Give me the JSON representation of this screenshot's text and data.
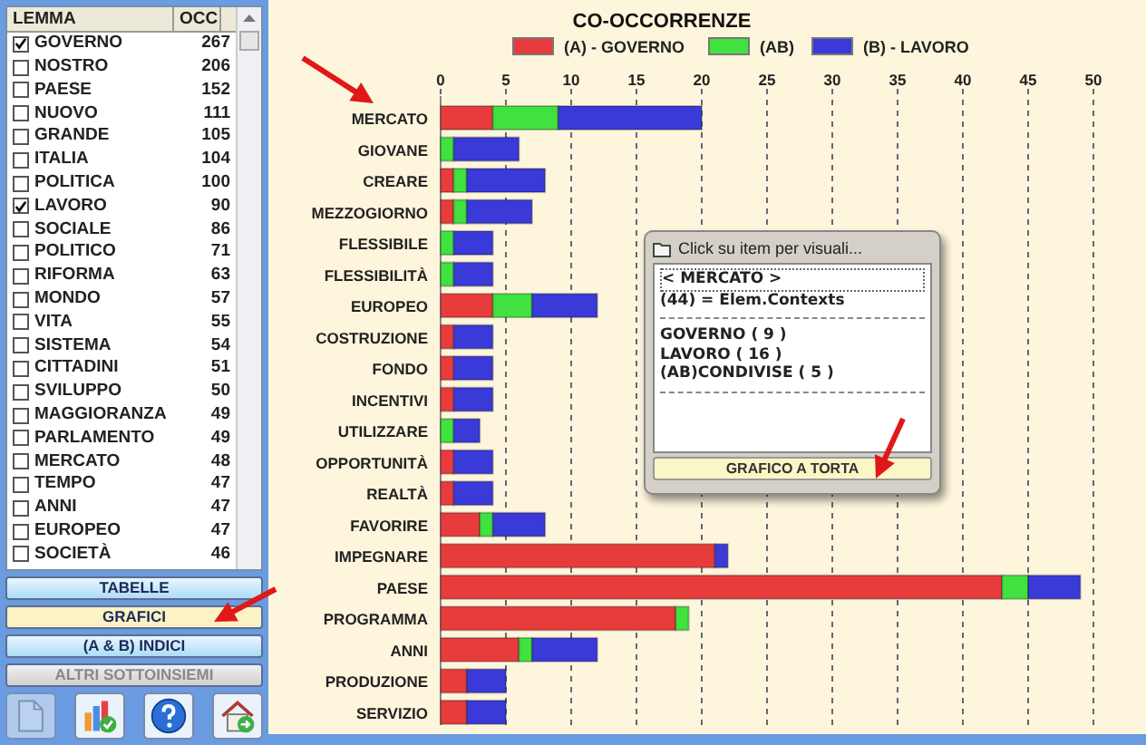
{
  "sidebar": {
    "columns": [
      "LEMMA",
      "OCC"
    ],
    "items": [
      {
        "label": "GOVERNO",
        "count": "267",
        "checked": true
      },
      {
        "label": "NOSTRO",
        "count": "206",
        "checked": false
      },
      {
        "label": "PAESE",
        "count": "152",
        "checked": false
      },
      {
        "label": "NUOVO",
        "count": "111",
        "checked": false
      },
      {
        "label": "GRANDE",
        "count": "105",
        "checked": false
      },
      {
        "label": "ITALIA",
        "count": "104",
        "checked": false
      },
      {
        "label": "POLITICA",
        "count": "100",
        "checked": false
      },
      {
        "label": "LAVORO",
        "count": "90",
        "checked": true
      },
      {
        "label": "SOCIALE",
        "count": "86",
        "checked": false
      },
      {
        "label": "POLITICO",
        "count": "71",
        "checked": false
      },
      {
        "label": "RIFORMA",
        "count": "63",
        "checked": false
      },
      {
        "label": "MONDO",
        "count": "57",
        "checked": false
      },
      {
        "label": "VITA",
        "count": "55",
        "checked": false
      },
      {
        "label": "SISTEMA",
        "count": "54",
        "checked": false
      },
      {
        "label": "CITTADINI",
        "count": "51",
        "checked": false
      },
      {
        "label": "SVILUPPO",
        "count": "50",
        "checked": false
      },
      {
        "label": "MAGGIORANZA",
        "count": "49",
        "checked": false
      },
      {
        "label": "PARLAMENTO",
        "count": "49",
        "checked": false
      },
      {
        "label": "MERCATO",
        "count": "48",
        "checked": false
      },
      {
        "label": "TEMPO",
        "count": "47",
        "checked": false
      },
      {
        "label": "ANNI",
        "count": "47",
        "checked": false
      },
      {
        "label": "EUROPEO",
        "count": "47",
        "checked": false
      },
      {
        "label": "SOCIETÀ",
        "count": "46",
        "checked": false
      }
    ],
    "buttons": [
      {
        "label": "TABELLE",
        "selected": false,
        "disabled": false
      },
      {
        "label": "GRAFICI",
        "selected": true,
        "disabled": false
      },
      {
        "label": "(A & B)  INDICI",
        "selected": false,
        "disabled": false
      },
      {
        "label": "ALTRI SOTTOINSIEMI",
        "selected": false,
        "disabled": true
      }
    ],
    "toolbar": [
      {
        "kind": "document",
        "disabled": true
      },
      {
        "kind": "chart",
        "disabled": false
      },
      {
        "kind": "help",
        "disabled": false
      },
      {
        "kind": "home",
        "disabled": false
      }
    ]
  },
  "chart": {
    "chart_data": {
      "type": "bar",
      "title": "CO-OCCORRENZE",
      "orientation": "horizontal",
      "stacked": true,
      "categories": [
        "MERCATO",
        "GIOVANE",
        "CREARE",
        "MEZZOGIORNO",
        "FLESSIBILE",
        "FLESSIBILITÀ",
        "EUROPEO",
        "COSTRUZIONE",
        "FONDO",
        "INCENTIVI",
        "UTILIZZARE",
        "OPPORTUNITÀ",
        "REALTÀ",
        "FAVORIRE",
        "IMPEGNARE",
        "PAESE",
        "PROGRAMMA",
        "ANNI",
        "PRODUZIONE",
        "SERVIZIO"
      ],
      "series": [
        {
          "name": "(A) - GOVERNO",
          "color": "#e83c3c",
          "values": [
            4,
            0,
            1,
            1,
            0,
            0,
            4,
            1,
            1,
            1,
            0,
            1,
            1,
            3,
            21,
            43,
            18,
            6,
            2,
            2
          ]
        },
        {
          "name": "(AB)",
          "color": "#3fe23f",
          "values": [
            5,
            1,
            1,
            1,
            1,
            1,
            3,
            0,
            0,
            0,
            1,
            0,
            0,
            1,
            0,
            2,
            1,
            1,
            0,
            0
          ]
        },
        {
          "name": "(B) - LAVORO",
          "color": "#3a3ad8",
          "values": [
            11,
            5,
            6,
            5,
            3,
            3,
            5,
            3,
            3,
            3,
            2,
            3,
            3,
            4,
            1,
            4,
            0,
            5,
            3,
            3
          ]
        }
      ],
      "xlim": [
        0,
        50
      ],
      "xticks": [
        0,
        5,
        10,
        15,
        20,
        25,
        30,
        35,
        40,
        45,
        50
      ],
      "grid": true,
      "legend": true
    }
  },
  "popup": {
    "title": "Click su item per visuali...",
    "header_lines": [
      {
        "text": "< MERCATO >",
        "selected": true
      },
      {
        "text": "(44) = Elem.Contexts",
        "selected": false
      }
    ],
    "count_lines": [
      {
        "text": "GOVERNO ( 9 )",
        "selected": false
      },
      {
        "text": "LAVORO ( 16 )",
        "selected": false
      },
      {
        "text": "(AB)CONDIVISE ( 5 )",
        "selected": false
      }
    ],
    "button": "GRAFICO A TORTA"
  }
}
